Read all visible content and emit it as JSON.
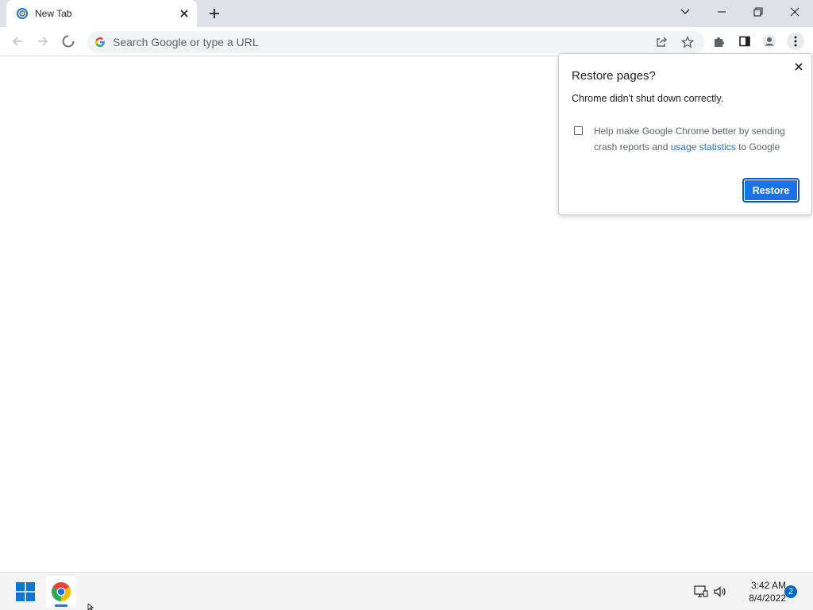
{
  "browser": {
    "tab": {
      "title": "New Tab",
      "favicon": "loading-favicon-icon"
    },
    "window_controls": [
      "tab-search-icon",
      "minimize-icon",
      "restore-icon",
      "close-icon"
    ]
  },
  "toolbar": {
    "omnibox_placeholder": "Search Google or type a URL",
    "icons": [
      "back-icon",
      "forward-icon",
      "stop-loading-icon",
      "google-g-icon",
      "share-icon",
      "bookmark-star-icon",
      "extensions-icon",
      "side-panel-icon",
      "profile-icon",
      "menu-icon"
    ]
  },
  "restore_bubble": {
    "title": "Restore pages?",
    "message": "Chrome didn't shut down correctly.",
    "checkbox_text_before": "Help make Google Chrome better by sending crash reports and ",
    "checkbox_link": "usage statistics",
    "checkbox_text_after": " to Google",
    "checkbox_checked": false,
    "button_label": "Restore"
  },
  "taskbar": {
    "time": "3:42 AM",
    "date": "8/4/2022",
    "notification_count": "2",
    "apps": [
      "windows-start-icon",
      "chrome-icon"
    ],
    "tray": [
      "network-icon",
      "volume-icon"
    ]
  },
  "colors": {
    "accent": "#1a73e8",
    "tabstrip": "#dee1e6",
    "omnibox": "#f1f3f4",
    "taskbar": "#f3f3f3"
  }
}
